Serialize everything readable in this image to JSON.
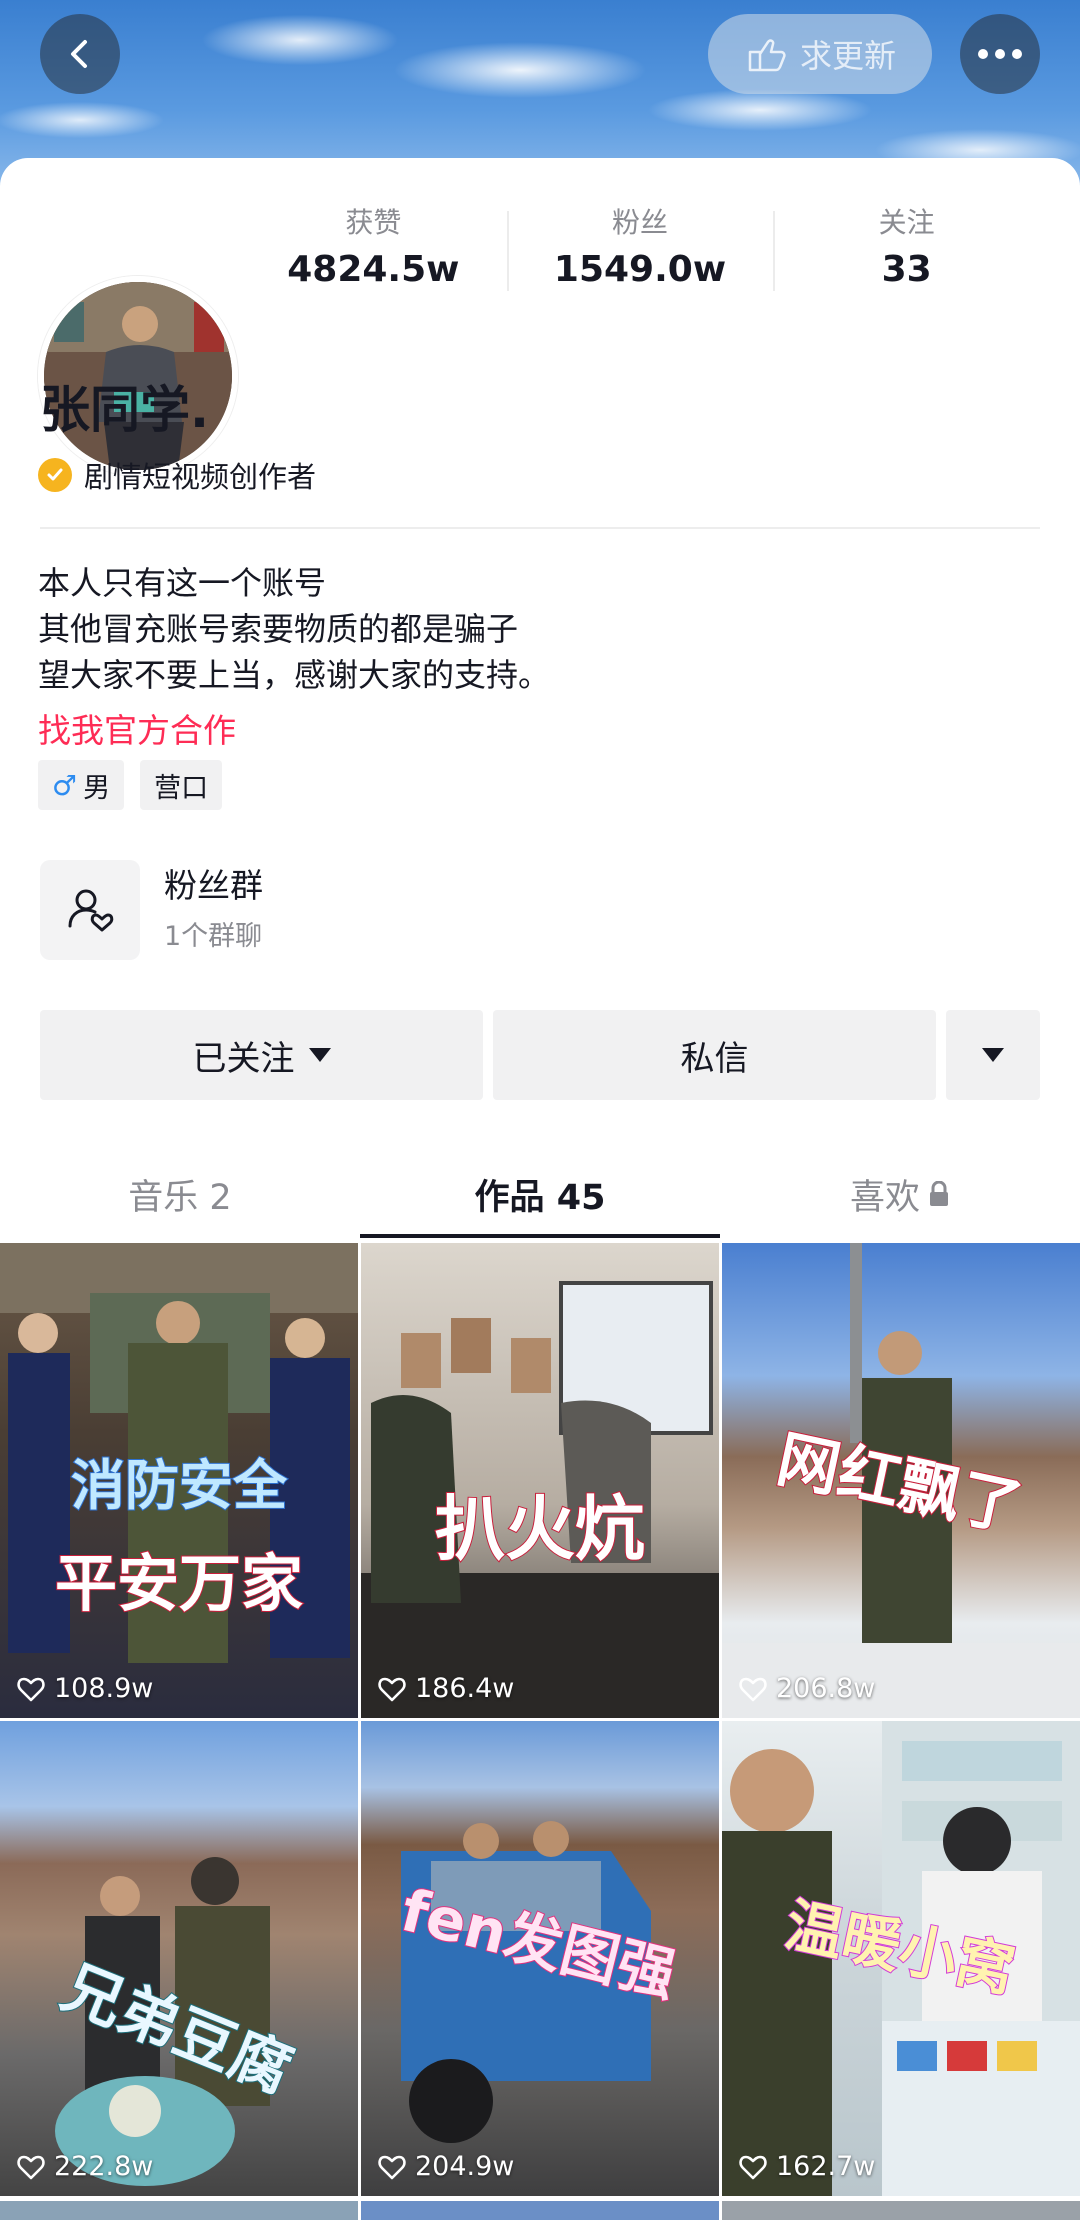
{
  "header": {
    "update_label": "求更新"
  },
  "profile": {
    "name": "张同学.",
    "verify_label": "剧情短视频创作者",
    "stats": [
      {
        "label": "获赞",
        "value": "4824.5w"
      },
      {
        "label": "粉丝",
        "value": "1549.0w"
      },
      {
        "label": "关注",
        "value": "33"
      }
    ],
    "bio": [
      "本人只有这一个账号",
      "其他冒充账号索要物质的都是骗子",
      "望大家不要上当，感谢大家的支持。"
    ],
    "cooperation_link": "找我官方合作",
    "tags": {
      "gender": "男",
      "location": "营口"
    }
  },
  "fans_group": {
    "title": "粉丝群",
    "subtitle": "1个群聊"
  },
  "actions": {
    "follow": "已关注",
    "message": "私信"
  },
  "tabs": [
    {
      "label": "音乐 2"
    },
    {
      "label": "作品 45"
    },
    {
      "label": "喜欢"
    }
  ],
  "videos": [
    {
      "caption1": "消防安全",
      "caption2": "平安万家",
      "likes": "108.9w"
    },
    {
      "caption1": "扒火炕",
      "likes": "186.4w"
    },
    {
      "caption1": "网红飘了",
      "likes": "206.8w"
    },
    {
      "caption1": "兄弟豆腐",
      "likes": "222.8w"
    },
    {
      "caption1": "fen发图强",
      "likes": "204.9w"
    },
    {
      "caption1": "温暖小窝",
      "likes": "162.7w"
    }
  ]
}
